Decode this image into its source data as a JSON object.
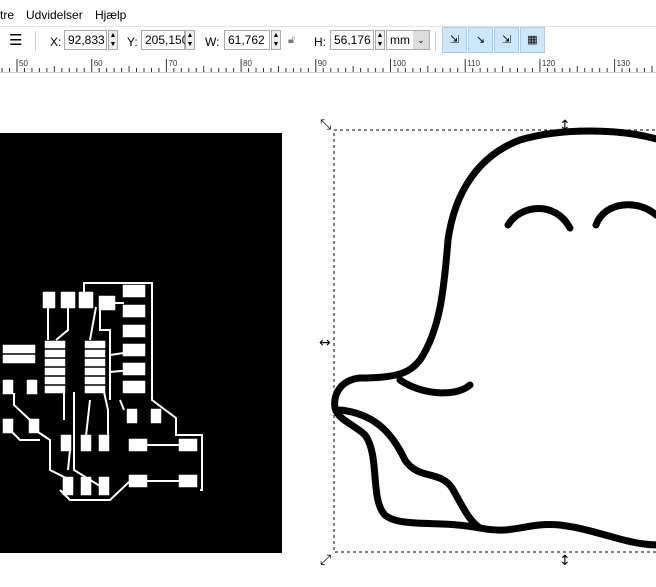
{
  "menu": [
    "tre",
    "Udvidelser",
    "Hjælp"
  ],
  "toolbar": {
    "x_label": "X:",
    "x": "92,833",
    "y_label": "Y:",
    "y": "205,150",
    "w_label": "W:",
    "w": "61,762",
    "h_label": "H:",
    "h": "56,176",
    "unit": "mm"
  },
  "ruler": {
    "ticks": [
      "50",
      "60",
      "70",
      "80",
      "90",
      "100",
      "110",
      "120",
      "130"
    ]
  }
}
